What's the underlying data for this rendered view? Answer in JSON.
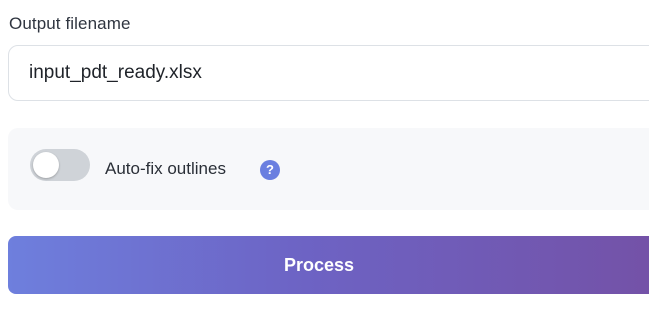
{
  "output": {
    "label": "Output filename",
    "filename_value": "input_pdt_ready.xlsx"
  },
  "options": {
    "auto_fix": {
      "label": "Auto-fix outlines",
      "enabled": false,
      "help_glyph": "?",
      "help_icon": "question-circle-icon"
    }
  },
  "actions": {
    "process_label": "Process"
  },
  "colors": {
    "accent": "#6a7fe0",
    "button_gradient_start": "#6e7fdd",
    "button_gradient_end": "#7451a6",
    "toggle_off": "#cfd3d8",
    "card_background": "#f7f8fa"
  }
}
